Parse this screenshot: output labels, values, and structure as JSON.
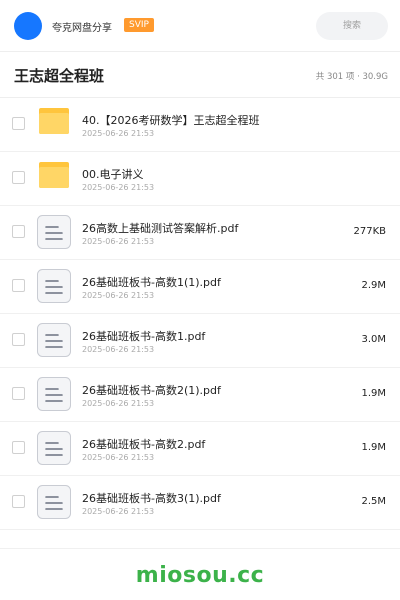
{
  "header": {
    "share_title": "夸克网盘分享",
    "badge": "SVIP",
    "search_placeholder": "搜索"
  },
  "folder": {
    "title": "王志超全程班",
    "summary": "共 301 项 · 30.9G"
  },
  "files": [
    {
      "type": "folder",
      "name": "40.【2026考研数学】王志超全程班",
      "date": "2025-06-26 21:53",
      "size": ""
    },
    {
      "type": "folder",
      "name": "00.电子讲义",
      "date": "2025-06-26 21:53",
      "size": ""
    },
    {
      "type": "doc",
      "name": "26高数上基础测试答案解析.pdf",
      "date": "2025-06-26 21:53",
      "size": "277KB"
    },
    {
      "type": "doc",
      "name": "26基础班板书-高数1(1).pdf",
      "date": "2025-06-26 21:53",
      "size": "2.9M"
    },
    {
      "type": "doc",
      "name": "26基础班板书-高数1.pdf",
      "date": "2025-06-26 21:53",
      "size": "3.0M"
    },
    {
      "type": "doc",
      "name": "26基础班板书-高数2(1).pdf",
      "date": "2025-06-26 21:53",
      "size": "1.9M"
    },
    {
      "type": "doc",
      "name": "26基础班板书-高数2.pdf",
      "date": "2025-06-26 21:53",
      "size": "1.9M"
    },
    {
      "type": "doc",
      "name": "26基础班板书-高数3(1).pdf",
      "date": "2025-06-26 21:53",
      "size": "2.5M"
    }
  ],
  "watermark": "miosou.cc",
  "colors": {
    "accent": "#1677ff",
    "badge": "#ff9a2e",
    "folder": "#ffc53d",
    "watermark": "#3cb24a"
  }
}
